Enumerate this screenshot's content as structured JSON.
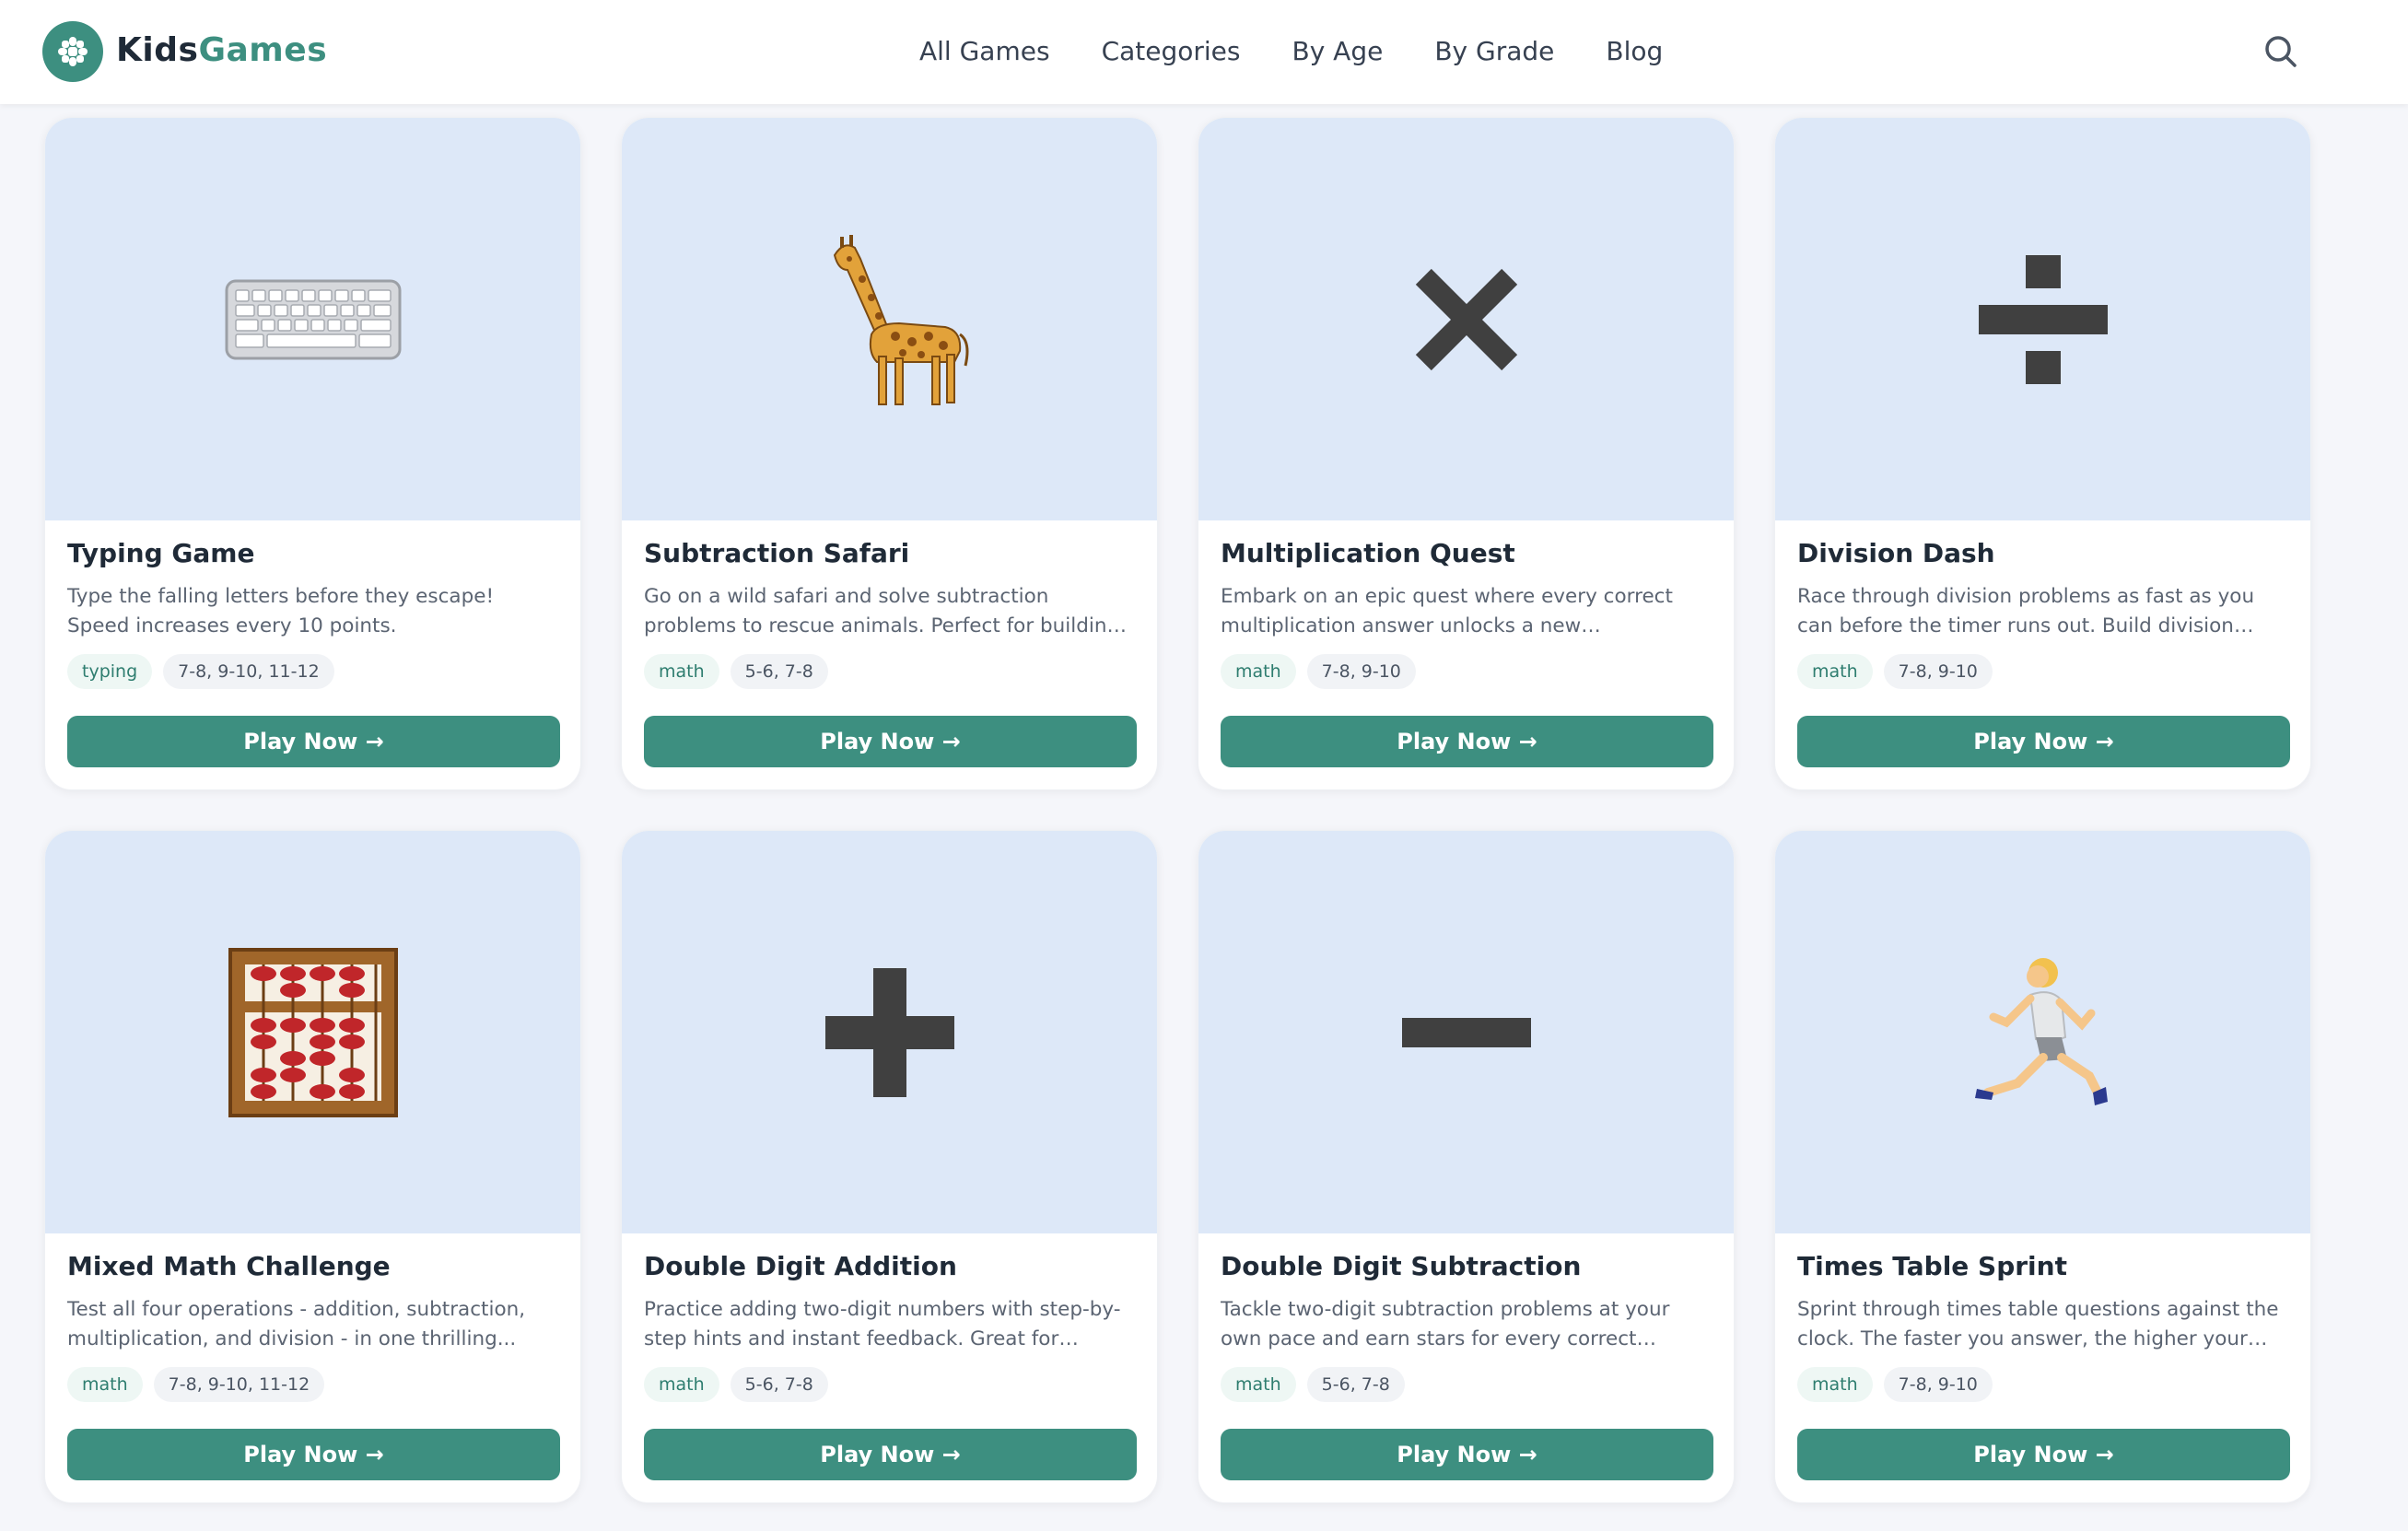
{
  "brand": {
    "name_part1": "Kids",
    "name_part2": "Games",
    "color": "#3d8f80",
    "logo_icon": "puzzle-flower-icon"
  },
  "nav": {
    "items": [
      "All Games",
      "Categories",
      "By Age",
      "By Grade",
      "Blog"
    ],
    "search_icon": "search-icon"
  },
  "colors": {
    "accent": "#3d8f80",
    "card_image_bg": "#dde8f8",
    "page_bg": "#f5f6fa"
  },
  "games": [
    {
      "title": "Typing Game",
      "description": "Type the falling letters before they escape! Speed increases every 10 points.",
      "category": "typing",
      "ages": "7-8, 9-10, 11-12",
      "icon": "keyboard-icon",
      "button": "Play Now →"
    },
    {
      "title": "Subtraction Safari",
      "description": "Go on a wild safari and solve subtraction problems to rescue animals. Perfect for building early numb...",
      "category": "math",
      "ages": "5-6, 7-8",
      "icon": "giraffe-icon",
      "button": "Play Now →"
    },
    {
      "title": "Multiplication Quest",
      "description": "Embark on an epic quest where every correct multiplication answer unlocks a new adventure....",
      "category": "math",
      "ages": "7-8, 9-10",
      "icon": "multiply-icon",
      "button": "Play Now →"
    },
    {
      "title": "Division Dash",
      "description": "Race through division problems as fast as you can before the timer runs out. Build division fluency...",
      "category": "math",
      "ages": "7-8, 9-10",
      "icon": "divide-icon",
      "button": "Play Now →"
    },
    {
      "title": "Mixed Math Challenge",
      "description": "Test all four operations - addition, subtraction, multiplication, and division - in one thrilling...",
      "category": "math",
      "ages": "7-8, 9-10, 11-12",
      "icon": "abacus-icon",
      "button": "Play Now →"
    },
    {
      "title": "Double Digit Addition",
      "description": "Practice adding two-digit numbers with step-by-step hints and instant feedback. Great for building...",
      "category": "math",
      "ages": "5-6, 7-8",
      "icon": "plus-icon",
      "button": "Play Now →"
    },
    {
      "title": "Double Digit Subtraction",
      "description": "Tackle two-digit subtraction problems at your own pace and earn stars for every correct answer. Buil...",
      "category": "math",
      "ages": "5-6, 7-8",
      "icon": "minus-icon",
      "button": "Play Now →"
    },
    {
      "title": "Times Table Sprint",
      "description": "Sprint through times table questions against the clock. The faster you answer, the higher your score!",
      "category": "math",
      "ages": "7-8, 9-10",
      "icon": "runner-icon",
      "button": "Play Now →"
    }
  ]
}
